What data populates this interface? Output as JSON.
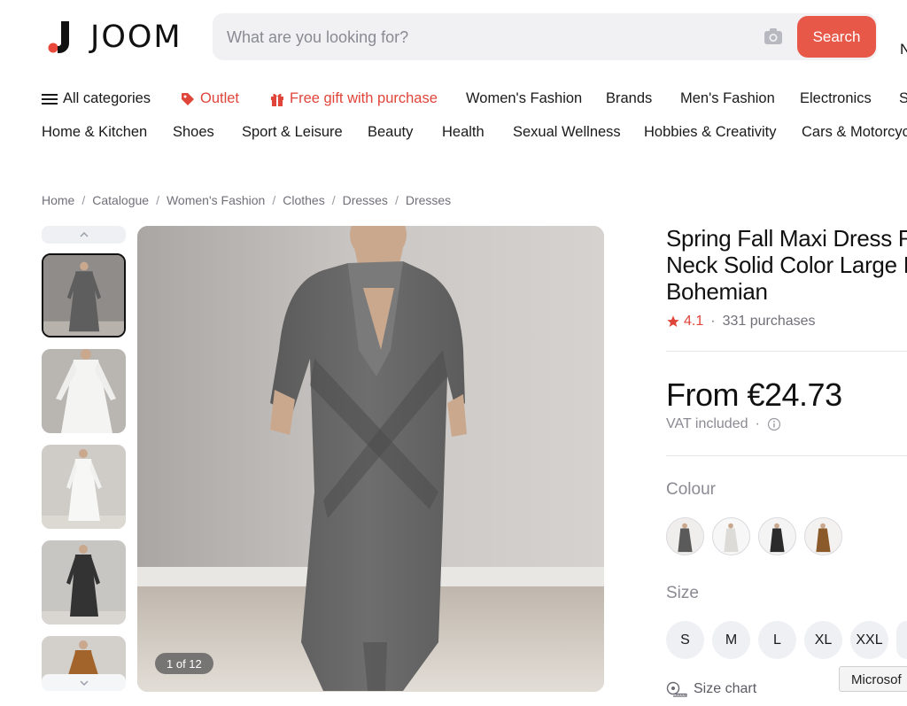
{
  "header": {
    "logo_text": "JOOM",
    "search_placeholder": "What are you looking for?",
    "search_button": "Search",
    "edge_letter": "N"
  },
  "nav": {
    "row1": [
      {
        "label": "All categories",
        "icon": "menu-icon"
      },
      {
        "label": "Outlet",
        "icon": "tag-icon",
        "color": "#e0453a"
      },
      {
        "label": "Free gift with purchase",
        "icon": "gift-icon",
        "color": "#e0453a"
      },
      {
        "label": "Women's Fashion"
      },
      {
        "label": "Brands"
      },
      {
        "label": "Men's Fashion"
      },
      {
        "label": "Electronics"
      },
      {
        "label": "S"
      }
    ],
    "row2": [
      {
        "label": "Home & Kitchen"
      },
      {
        "label": "Shoes"
      },
      {
        "label": "Sport & Leisure"
      },
      {
        "label": "Beauty"
      },
      {
        "label": "Health"
      },
      {
        "label": "Sexual Wellness"
      },
      {
        "label": "Hobbies & Creativity"
      },
      {
        "label": "Cars & Motorcycl"
      }
    ]
  },
  "breadcrumb": [
    "Home",
    "Catalogue",
    "Women's Fashion",
    "Clothes",
    "Dresses",
    "Dresses"
  ],
  "gallery": {
    "counter": "1 of 12",
    "thumbnails": [
      {
        "color": "#5e5e5e",
        "bg": "#8f8c89"
      },
      {
        "color": "#f4f4f2",
        "bg": "#b9b6b2"
      },
      {
        "color": "#f7f7f5",
        "bg": "#cfccc8"
      },
      {
        "color": "#333333",
        "bg": "#c8c6c3"
      },
      {
        "color": "#a2642a",
        "bg": "#d3d0cc"
      }
    ]
  },
  "product": {
    "title": "Spring Fall Maxi Dress R Neck Solid Color Large I Bohemian",
    "rating": "4.1",
    "purchases": "331 purchases",
    "price": "From €24.73",
    "vat": "VAT included",
    "colour_label": "Colour",
    "colours": [
      "#5a5a5a",
      "#ecebe8",
      "#2b2b2b",
      "#8a5a2a"
    ],
    "size_label": "Size",
    "sizes": [
      "S",
      "M",
      "L",
      "XL",
      "XXL",
      ""
    ],
    "size_chart": "Size chart",
    "accent": "#e85848"
  },
  "tooltip": "Microsof"
}
